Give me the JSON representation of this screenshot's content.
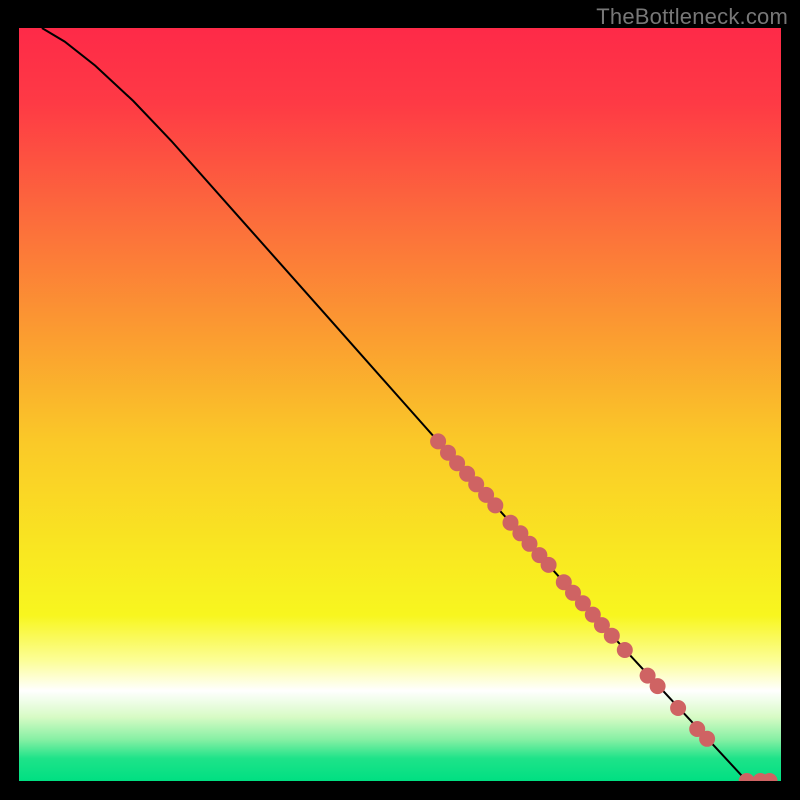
{
  "attribution": "TheBottleneck.com",
  "colors": {
    "point_fill": "#cf6363",
    "line_stroke": "#000000",
    "gradient_stops": [
      {
        "offset": 0.0,
        "color": "#fe2a48"
      },
      {
        "offset": 0.1,
        "color": "#fe3a45"
      },
      {
        "offset": 0.25,
        "color": "#fc6b3c"
      },
      {
        "offset": 0.4,
        "color": "#fb9a31"
      },
      {
        "offset": 0.55,
        "color": "#fac928"
      },
      {
        "offset": 0.7,
        "color": "#f9e821"
      },
      {
        "offset": 0.78,
        "color": "#f8f61f"
      },
      {
        "offset": 0.84,
        "color": "#fcfe97"
      },
      {
        "offset": 0.88,
        "color": "#ffffff"
      },
      {
        "offset": 0.915,
        "color": "#d7fbc5"
      },
      {
        "offset": 0.945,
        "color": "#86f0a4"
      },
      {
        "offset": 0.97,
        "color": "#1ee389"
      },
      {
        "offset": 1.0,
        "color": "#00df82"
      }
    ]
  },
  "chart_data": {
    "type": "scatter",
    "title": "",
    "xlabel": "",
    "ylabel": "",
    "xlim": [
      0,
      100
    ],
    "ylim": [
      0,
      100
    ],
    "curve": [
      {
        "x": 3.0,
        "y": 100.0
      },
      {
        "x": 6.0,
        "y": 98.2
      },
      {
        "x": 10.0,
        "y": 95.0
      },
      {
        "x": 15.0,
        "y": 90.3
      },
      {
        "x": 20.0,
        "y": 85.0
      },
      {
        "x": 30.0,
        "y": 73.6
      },
      {
        "x": 40.0,
        "y": 62.2
      },
      {
        "x": 50.0,
        "y": 50.8
      },
      {
        "x": 60.0,
        "y": 39.4
      },
      {
        "x": 70.0,
        "y": 28.1
      },
      {
        "x": 80.0,
        "y": 16.9
      },
      {
        "x": 90.0,
        "y": 6.0
      },
      {
        "x": 95.5,
        "y": 0.0
      }
    ],
    "series": [
      {
        "name": "points",
        "x": [
          55.0,
          56.3,
          57.5,
          58.8,
          60.0,
          61.3,
          62.5,
          64.5,
          65.8,
          67.0,
          68.3,
          69.5,
          71.5,
          72.7,
          74.0,
          75.3,
          76.5,
          77.8,
          79.5,
          82.5,
          83.8,
          86.5,
          89.0,
          90.3,
          95.5,
          97.3,
          98.5
        ],
        "y": [
          45.1,
          43.6,
          42.2,
          40.8,
          39.4,
          38.0,
          36.6,
          34.3,
          32.9,
          31.5,
          30.0,
          28.7,
          26.4,
          25.0,
          23.6,
          22.1,
          20.7,
          19.3,
          17.4,
          14.0,
          12.6,
          9.7,
          6.9,
          5.6,
          0.0,
          0.0,
          0.0
        ]
      }
    ]
  }
}
